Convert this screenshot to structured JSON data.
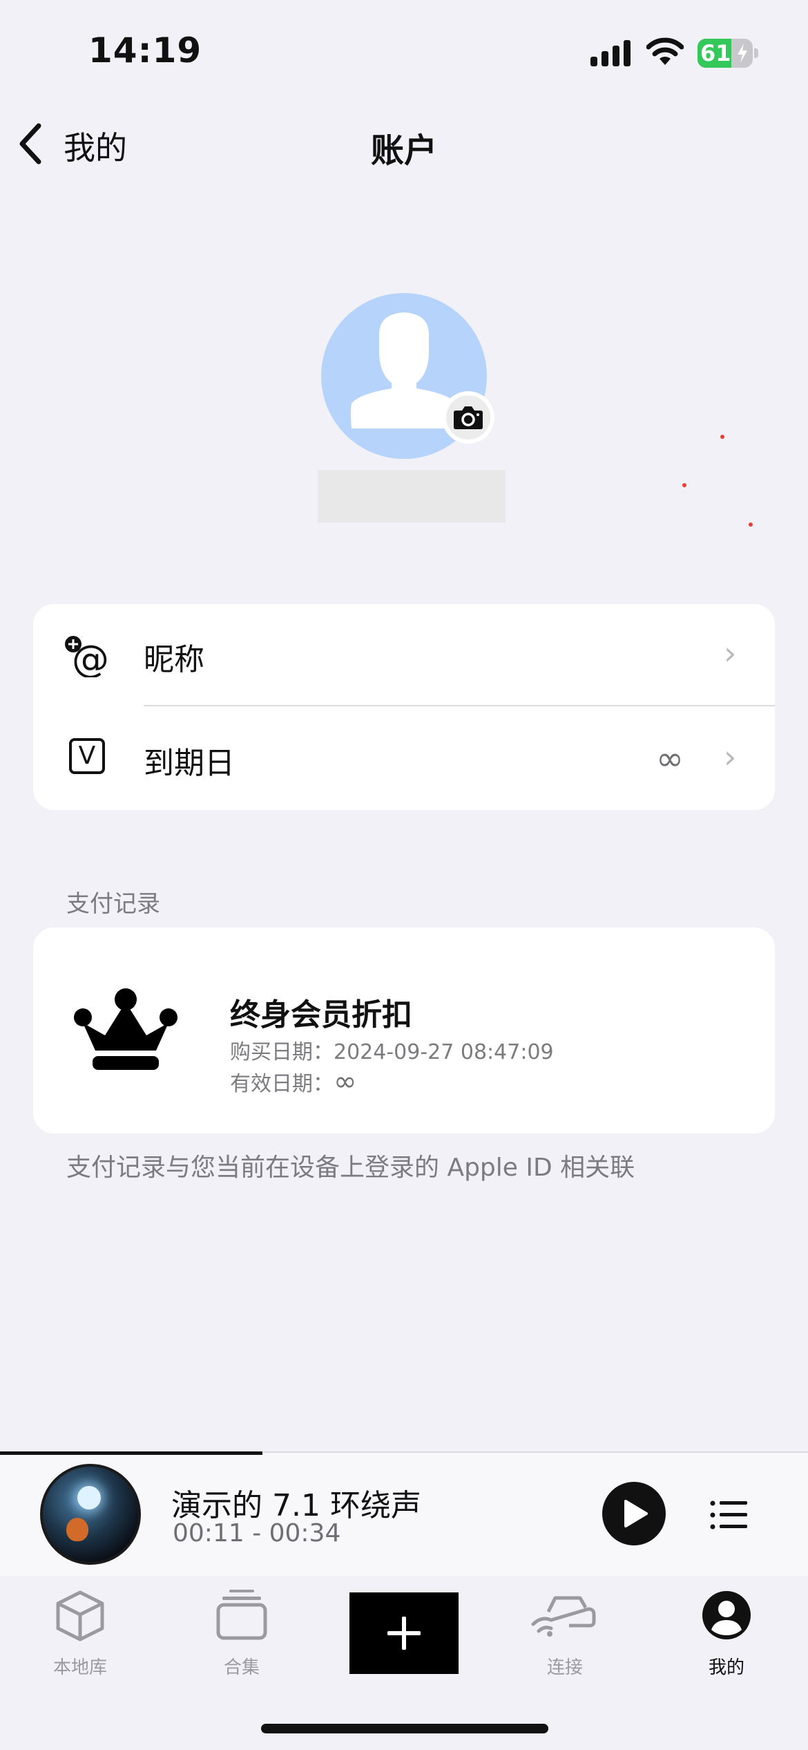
{
  "status_bar": {
    "time": "14:19",
    "battery": "61"
  },
  "nav": {
    "back_label": "我的",
    "title": "账户"
  },
  "account_rows": [
    {
      "label": "昵称",
      "value": ""
    },
    {
      "label": "到期日",
      "value": "∞"
    }
  ],
  "payment": {
    "section_label": "支付记录",
    "title": "终身会员折扣",
    "purchase_label": "购买日期：",
    "purchase_date": "2024-09-27 08:47:09",
    "valid_label": "有效日期：",
    "valid_value": "∞",
    "note": "支付记录与您当前在设备上登录的 Apple ID 相关联"
  },
  "player": {
    "title": "演示的 7.1 环绕声",
    "time": "00:11 - 00:34",
    "progress": 0.325
  },
  "tabs": [
    {
      "label": "本地库",
      "icon": "box-icon"
    },
    {
      "label": "合集",
      "icon": "collection-icon"
    },
    {
      "label": "",
      "icon": "plus-icon"
    },
    {
      "label": "连接",
      "icon": "connect-icon"
    },
    {
      "label": "我的",
      "icon": "profile-icon",
      "active": true
    }
  ],
  "colors": {
    "background": "#f2f1f7",
    "accent": "#000000",
    "avatar": "#b6d3fb",
    "battery": "#34c759"
  }
}
